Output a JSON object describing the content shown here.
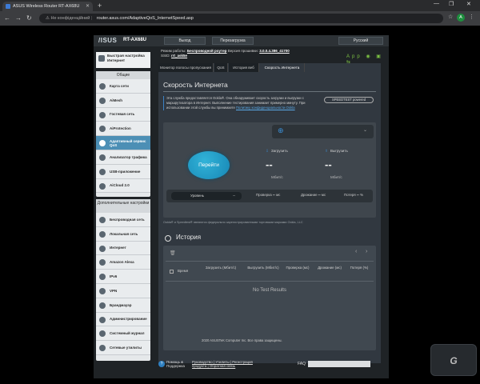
{
  "browser": {
    "tab_title": "ASUS Wireless Router RT-AX68U",
    "insecure_label": "Не конфіденційний",
    "url": "router.asus.com/AdaptiveQoS_InternetSpeed.asp",
    "profile_initial": "A"
  },
  "header": {
    "logo": "/ISUS",
    "model": "RT-AX68U",
    "logout": "Выход",
    "reboot": "Перезагрузка",
    "language": "Русский",
    "info": {
      "mode_label": "Режим работы:",
      "mode_value": "Беспроводной роутер",
      "firmware_label": "Версия прошивки:",
      "firmware_value": "3.0.0.4.386_41700",
      "ssid_label": "SSID:",
      "ssid_value": "rrt_ask5e"
    },
    "status_label": "App"
  },
  "sidebar": {
    "quick_setup": "Быстрая настройка Интернет",
    "general_title": "Общие",
    "general_items": [
      {
        "label": "Карта сети"
      },
      {
        "label": "AiMesh"
      },
      {
        "label": "Гостевая сеть"
      },
      {
        "label": "AiProtection"
      },
      {
        "label": "Адаптивный сервис QoS"
      },
      {
        "label": "Анализатор трафика"
      },
      {
        "label": "USB-приложение"
      },
      {
        "label": "AiCloud 2.0"
      }
    ],
    "advanced_title": "Дополнительные настройки",
    "advanced_items": [
      {
        "label": "Беспроводная сеть"
      },
      {
        "label": "Локальная сеть"
      },
      {
        "label": "Интернет"
      },
      {
        "label": "Amazon Alexa"
      },
      {
        "label": "IPv6"
      },
      {
        "label": "VPN"
      },
      {
        "label": "Брандмауэр"
      },
      {
        "label": "Администрирование"
      },
      {
        "label": "Системный журнал"
      },
      {
        "label": "Сетевые утилиты"
      }
    ]
  },
  "tabs": [
    "Монитор полосы пропускания",
    "QoS",
    "История веб",
    "Скорость Интернета"
  ],
  "speed": {
    "title": "Скорость Интернета",
    "desc_1": "Эта служба предоставляется Ookla®. Она обнаруживает скорость загрузки и выгрузки с маршрутизатора в Интернет. Выполнение тестирования занимает примерно минуту. При использовании этой службы вы принимаете ",
    "desc_link": "Политику конфиденциальности Ookla",
    "speedtest_badge": "SPEEDTEST powered",
    "go_button": "Перейти",
    "download_label": "Загрузить",
    "upload_label": "Выгрузить",
    "download_value": "--",
    "upload_value": "--",
    "download_unit": "Мбит/с",
    "upload_unit": "Мбит/с",
    "level_label": "Уровень",
    "level_value": "--",
    "ping_label": "Проверка",
    "ping_value": "--",
    "ping_unit": "мс",
    "jitter_label": "Дрожание",
    "jitter_value": "--",
    "jitter_unit": "мс",
    "loss_label": "Потеря",
    "loss_value": "--",
    "loss_unit": "%",
    "footnote": "Ookla® и Speedtest® являются федерально зарегистрированными торговыми марками Ookla, LLC"
  },
  "history": {
    "title": "История",
    "col_time": "Время",
    "col_download": "Загрузить (Мбит/с)",
    "col_upload": "Выгрузить (Мбит/с)",
    "col_ping": "Проверка (мс)",
    "col_jitter": "Дрожание (мс)",
    "col_loss": "Потеря (%)",
    "no_results": "No Test Results"
  },
  "footer": {
    "help": "Помощь & Поддержка",
    "links": "Руководство | Утилиты | Регистрация продукта | Обратная связь",
    "faq": "FAQ",
    "copyright": "2020 ASUSTeK Computer Inc. Все права защищены."
  },
  "watermark": "GECID"
}
